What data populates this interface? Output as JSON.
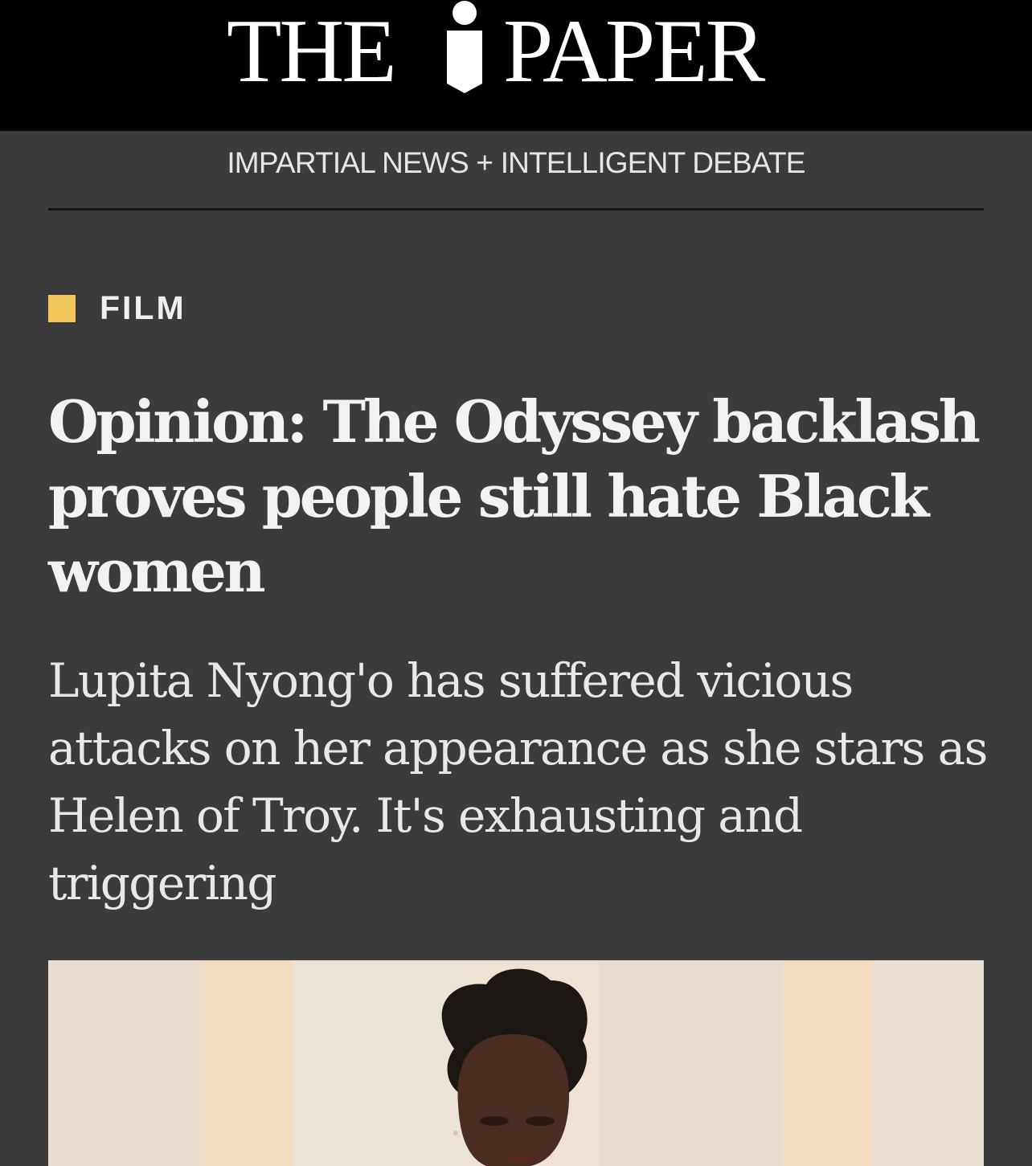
{
  "masthead": {
    "logo_text_left": "THE",
    "logo_text_right": "PAPER",
    "logo_mark": "i-icon",
    "tagline": "IMPARTIAL NEWS + INTELLIGENT DEBATE"
  },
  "article": {
    "section_label": "FILM",
    "section_color": "#f2c75c",
    "headline": "Opinion: The Odyssey backlash proves people still hate Black women",
    "standfirst": "Lupita Nyong'o has suffered vicious attacks on her appearance as she stars as Helen of Troy. It's exhausting and triggering"
  },
  "colors": {
    "masthead_bg": "#000000",
    "page_bg": "#3b3b3b",
    "text": "#f2f2f2"
  }
}
